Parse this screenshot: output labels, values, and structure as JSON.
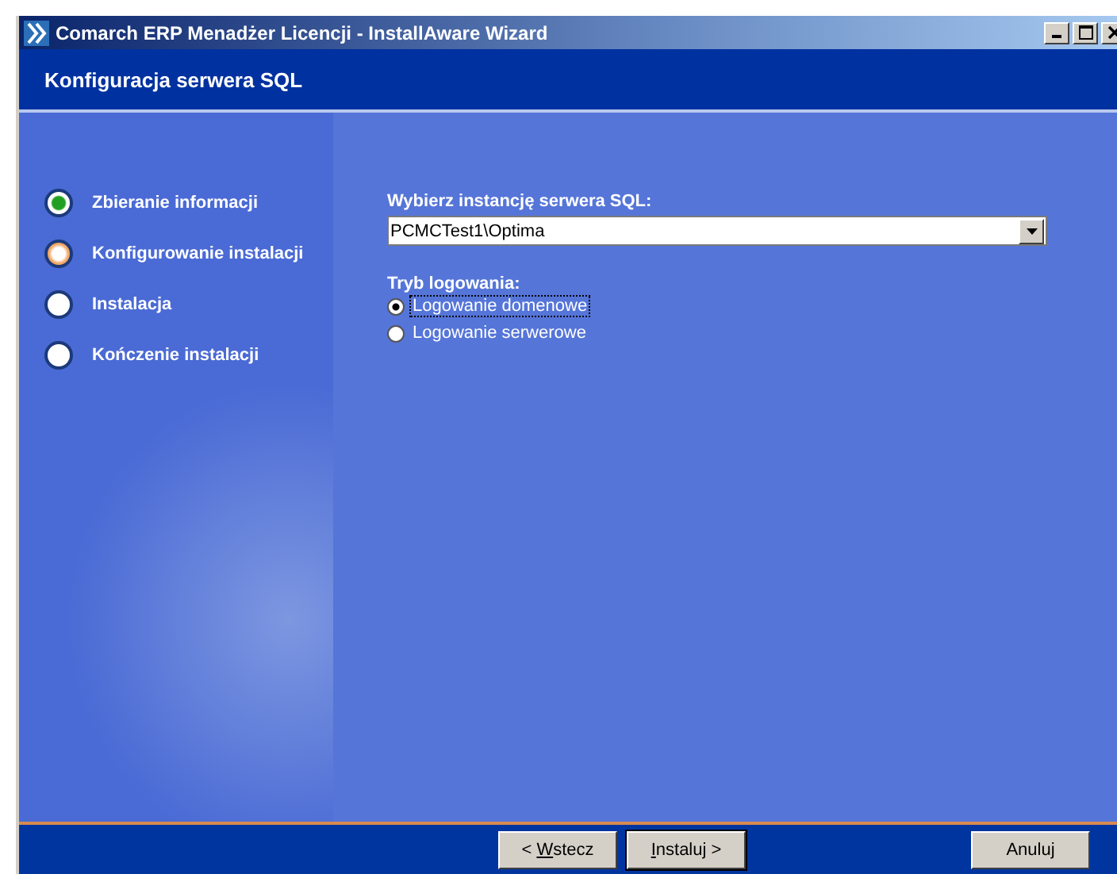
{
  "window": {
    "title": "Comarch ERP Menadżer Licencji - InstallAware Wizard"
  },
  "header": {
    "title": "Konfiguracja serwera SQL"
  },
  "steps": [
    {
      "label": "Zbieranie informacji",
      "kind": "done"
    },
    {
      "label": "Konfigurowanie instalacji",
      "kind": "current"
    },
    {
      "label": "Instalacja",
      "kind": "pending"
    },
    {
      "label": "Kończenie instalacji",
      "kind": "pending"
    }
  ],
  "instance": {
    "label": "Wybierz instancję serwera SQL:",
    "value": "PCMCTest1\\Optima"
  },
  "login_mode": {
    "label": "Tryb logowania:",
    "options": [
      {
        "label": "Logowanie domenowe",
        "selected": true
      },
      {
        "label": "Logowanie serwerowe",
        "selected": false
      }
    ]
  },
  "buttons": [
    {
      "before": "< ",
      "access_key": "W",
      "after": "stecz",
      "default": false
    },
    {
      "access_key": "I",
      "after": "nstaluj >",
      "default": true
    },
    {
      "after": "Anuluj",
      "default": false
    }
  ]
}
